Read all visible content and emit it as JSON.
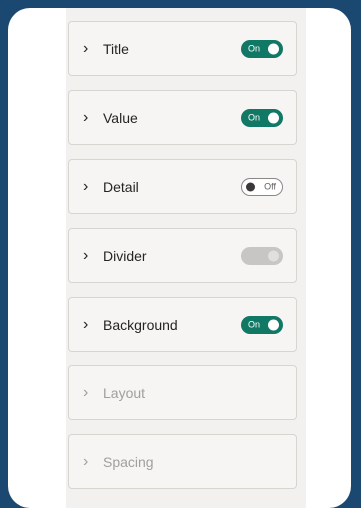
{
  "sections": [
    {
      "label": "Title",
      "toggle": "on",
      "toggle_text": "On"
    },
    {
      "label": "Value",
      "toggle": "on",
      "toggle_text": "On"
    },
    {
      "label": "Detail",
      "toggle": "off",
      "toggle_text": "Off"
    },
    {
      "label": "Divider",
      "toggle": "disabled",
      "toggle_text": ""
    },
    {
      "label": "Background",
      "toggle": "on",
      "toggle_text": "On"
    },
    {
      "label": "Layout",
      "disabled": true
    },
    {
      "label": "Spacing",
      "disabled": true
    }
  ],
  "icons": {
    "expand": "chevron-right-icon"
  },
  "colors": {
    "toggle_on": "#117865",
    "background": "#1b4870"
  }
}
